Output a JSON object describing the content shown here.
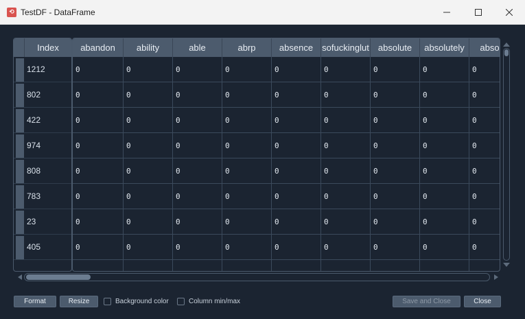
{
  "window": {
    "title": "TestDF - DataFrame",
    "app_icon_text": "⟲"
  },
  "table": {
    "index_header": "Index",
    "columns": [
      "abandon",
      "ability",
      "able",
      "abrp",
      "absence",
      "sofuckinglut",
      "absolute",
      "absolutely",
      "abso"
    ],
    "index": [
      "1212",
      "802",
      "422",
      "974",
      "808",
      "783",
      "23",
      "405"
    ],
    "rows": [
      [
        "0",
        "0",
        "0",
        "0",
        "0",
        "0",
        "0",
        "0",
        "0"
      ],
      [
        "0",
        "0",
        "0",
        "0",
        "0",
        "0",
        "0",
        "0",
        "0"
      ],
      [
        "0",
        "0",
        "0",
        "0",
        "0",
        "0",
        "0",
        "0",
        "0"
      ],
      [
        "0",
        "0",
        "0",
        "0",
        "0",
        "0",
        "0",
        "0",
        "0"
      ],
      [
        "0",
        "0",
        "0",
        "0",
        "0",
        "0",
        "0",
        "0",
        "0"
      ],
      [
        "0",
        "0",
        "0",
        "0",
        "0",
        "0",
        "0",
        "0",
        "0"
      ],
      [
        "0",
        "0",
        "0",
        "0",
        "0",
        "0",
        "0",
        "0",
        "0"
      ],
      [
        "0",
        "0",
        "0",
        "0",
        "0",
        "0",
        "0",
        "0",
        "0"
      ]
    ]
  },
  "footer": {
    "format_label": "Format",
    "resize_label": "Resize",
    "background_color_label": "Background color",
    "column_minmax_label": "Column min/max",
    "save_close_label": "Save and Close",
    "close_label": "Close"
  },
  "colors": {
    "background": "#1b2431",
    "header": "#4c5b6d",
    "grid": "#3b4a5c"
  }
}
